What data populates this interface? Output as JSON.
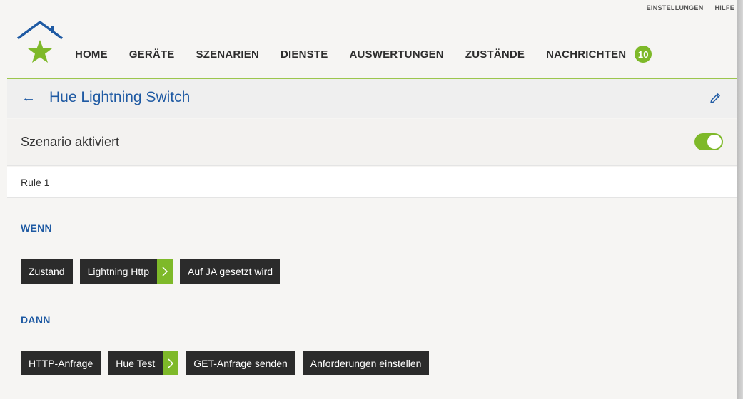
{
  "topbar": {
    "settings": "EINSTELLUNGEN",
    "help": "HILFE"
  },
  "nav": {
    "items": [
      "HOME",
      "GERÄTE",
      "SZENARIEN",
      "DIENSTE",
      "AUSWERTUNGEN",
      "ZUSTÄNDE"
    ],
    "messages_label": "NACHRICHTEN",
    "messages_count": "10"
  },
  "page": {
    "title": "Hue Lightning Switch"
  },
  "scenario": {
    "toggle_label": "Szenario aktiviert",
    "enabled": true
  },
  "rule": {
    "label": "Rule 1"
  },
  "when": {
    "label": "WENN",
    "chips": [
      {
        "text": "Zustand"
      },
      {
        "text": "Lightning Http",
        "has_arrow": true
      },
      {
        "text": "Auf JA gesetzt wird"
      }
    ]
  },
  "then": {
    "label": "DANN",
    "chips": [
      {
        "text": "HTTP-Anfrage"
      },
      {
        "text": "Hue Test",
        "has_arrow": true
      },
      {
        "text": "GET-Anfrage senden"
      },
      {
        "text": "Anforderungen einstellen"
      }
    ]
  },
  "colors": {
    "accent_green": "#7eb929",
    "title_blue": "#1f5aa3",
    "chip_dark": "#2b2b2b"
  }
}
